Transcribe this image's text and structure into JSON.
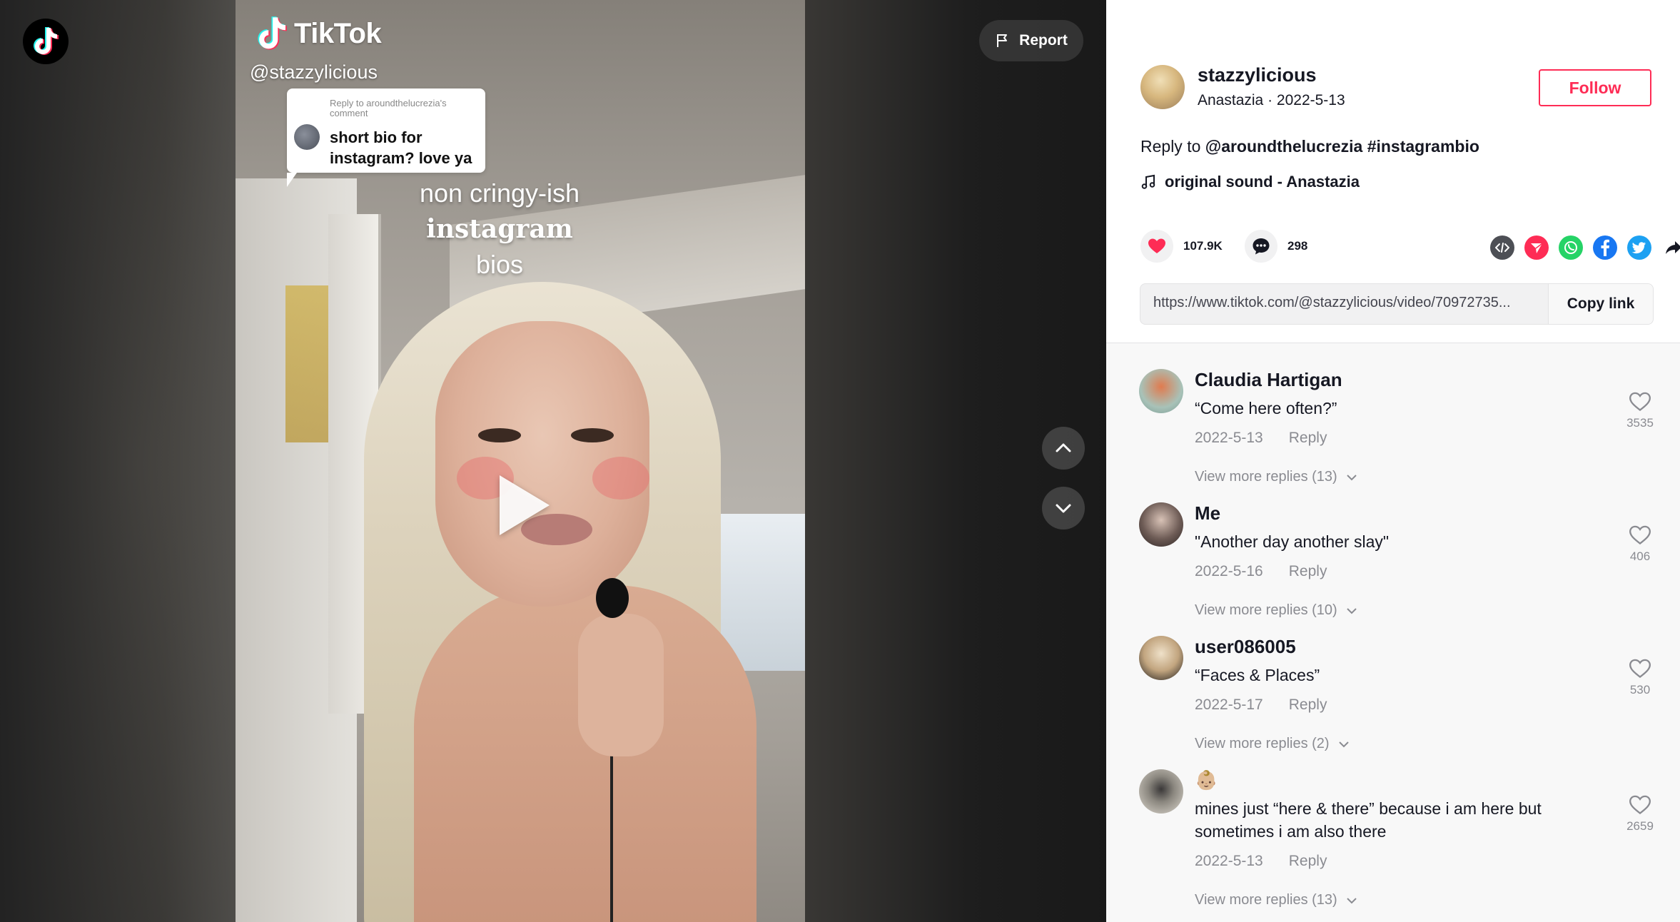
{
  "report": {
    "label": "Report"
  },
  "watermark": {
    "brand": "TikTok",
    "handle": "@stazzylicious"
  },
  "reply_bubble": {
    "heading": "Reply to aroundthelucrezia's comment",
    "text": "short bio for instagram? love ya"
  },
  "overlay": {
    "line1": "non cringy-ish",
    "line2": "instagram",
    "line3": "bios"
  },
  "author": {
    "username": "stazzylicious",
    "nickname": "Anastazia",
    "date": "2022-5-13",
    "follow_label": "Follow"
  },
  "caption": {
    "prefix": "Reply to",
    "mention": "@aroundthelucrezia",
    "hashtag": "#instagrambio"
  },
  "music": {
    "title": "original sound - Anastazia"
  },
  "stats": {
    "likes": "107.9K",
    "comments": "298"
  },
  "share": {
    "link": "https://www.tiktok.com/@stazzylicious/video/70972735...",
    "copy_label": "Copy link"
  },
  "colors": {
    "accent": "#fe2c55",
    "facebook": "#1877f2",
    "twitter": "#1da1f2",
    "whatsapp": "#25d366",
    "telegram": "#fe2c55",
    "embed": "#4d4f55"
  },
  "comments": [
    {
      "name": "Claudia Hartigan",
      "text": "“Come here often?”",
      "date": "2022-5-13",
      "reply": "Reply",
      "likes": "3535",
      "more": "View more replies (13)"
    },
    {
      "name": "Me",
      "text": "\"Another day another slay\"",
      "date": "2022-5-16",
      "reply": "Reply",
      "likes": "406",
      "more": "View more replies (10)"
    },
    {
      "name": "user086005",
      "text": "“Faces & Places”",
      "date": "2022-5-17",
      "reply": "Reply",
      "likes": "530",
      "more": "View more replies (2)"
    },
    {
      "name": "👶🏼",
      "text": "mines just “here & there” because i am here but sometimes i am also there",
      "date": "2022-5-13",
      "reply": "Reply",
      "likes": "2659",
      "more": "View more replies (13)"
    }
  ]
}
